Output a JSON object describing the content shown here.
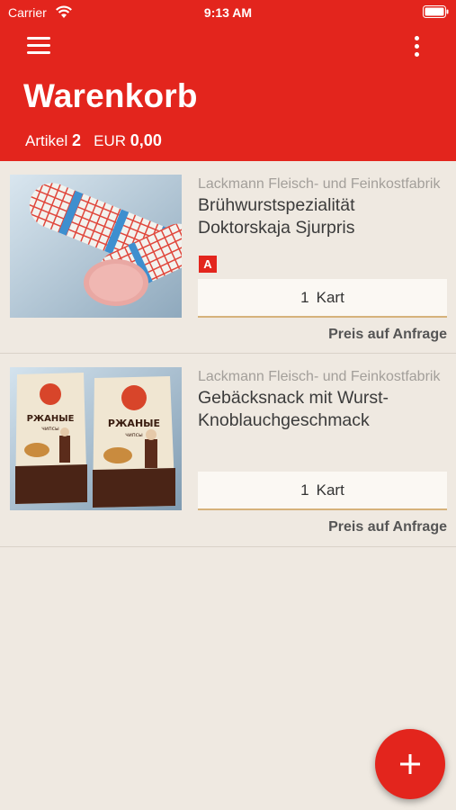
{
  "status_bar": {
    "carrier": "Carrier",
    "time": "9:13 AM"
  },
  "header": {
    "title": "Warenkorb",
    "articles_label": "Artikel",
    "articles_count": "2",
    "currency": "EUR",
    "total": "0,00"
  },
  "items": [
    {
      "vendor": "Lackmann Fleisch- und Feinkostfabrik",
      "name": "Brühwurstspezialität Doktorskaja Sjurpris",
      "badge": "A",
      "quantity": "1",
      "unit": "Kart",
      "price": "Preis auf Anfrage"
    },
    {
      "vendor": "Lackmann Fleisch- und Feinkostfabrik",
      "name": "Gebäcksnack mit Wurst-Knoblauchgeschmack",
      "quantity": "1",
      "unit": "Kart",
      "price": "Preis auf Anfrage"
    }
  ],
  "package_labels": {
    "brand": "РЖАНЫЕ",
    "sub": "чипсы"
  },
  "colors": {
    "brand": "#e3251d",
    "background": "#efe9e1",
    "accent_underline": "#d6b27b"
  },
  "icons": {
    "menu": "hamburger-icon",
    "more": "more-vertical-icon",
    "add": "plus-icon",
    "wifi": "wifi-icon",
    "battery": "battery-icon"
  }
}
